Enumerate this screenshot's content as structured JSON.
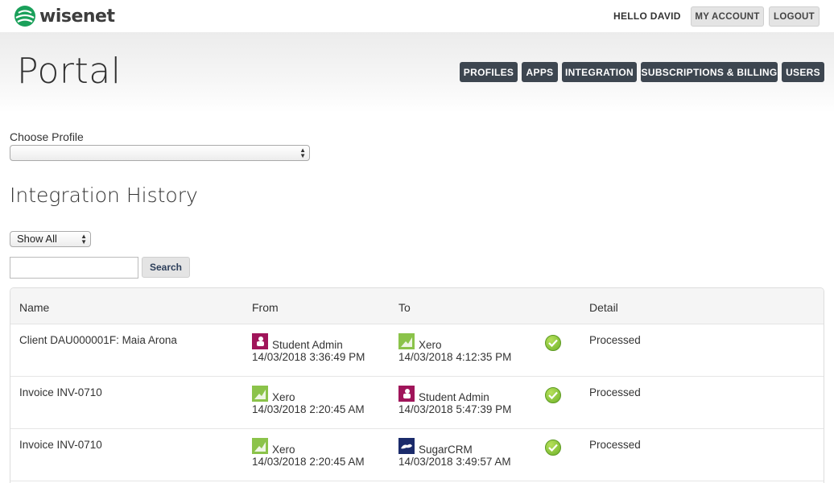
{
  "brand": {
    "name": "wisenet"
  },
  "topbar": {
    "greeting": "HELLO DAVID",
    "account_label": "MY ACCOUNT",
    "logout_label": "LOGOUT"
  },
  "header": {
    "title": "Portal",
    "nav": [
      "PROFILES",
      "APPS",
      "INTEGRATION",
      "SUBSCRIPTIONS & BILLING",
      "USERS"
    ]
  },
  "profile": {
    "label": "Choose Profile",
    "value": ""
  },
  "history": {
    "heading": "Integration History",
    "filter_value": "Show All",
    "search_value": "",
    "search_label": "Search"
  },
  "table": {
    "headers": {
      "name": "Name",
      "from": "From",
      "to": "To",
      "detail": "Detail"
    },
    "rows": [
      {
        "name": "Client DAU000001F: Maia Arona",
        "from": {
          "app": "Student Admin",
          "icon": "student-admin-icon",
          "time": "14/03/2018 3:36:49 PM"
        },
        "to": {
          "app": "Xero",
          "icon": "xero-icon",
          "time": "14/03/2018 4:12:35 PM"
        },
        "status_icon": "check-icon",
        "detail": "Processed"
      },
      {
        "name": "Invoice INV-0710",
        "from": {
          "app": "Xero",
          "icon": "xero-icon",
          "time": "14/03/2018 2:20:45 AM"
        },
        "to": {
          "app": "Student Admin",
          "icon": "student-admin-icon",
          "time": "14/03/2018 5:47:39 PM"
        },
        "status_icon": "check-icon",
        "detail": "Processed"
      },
      {
        "name": "Invoice INV-0710",
        "from": {
          "app": "Xero",
          "icon": "xero-icon",
          "time": "14/03/2018 2:20:45 AM"
        },
        "to": {
          "app": "SugarCRM",
          "icon": "sugarcrm-icon",
          "time": "14/03/2018 3:49:57 AM"
        },
        "status_icon": "check-icon",
        "detail": "Processed"
      }
    ]
  },
  "colors": {
    "nav_bg": "#3d4650",
    "brand_green": "#1aa05a",
    "student_admin": "#a0155a",
    "xero_green": "#8bc34a",
    "sugarcrm": "#1b2b6b",
    "status_green": "#7fc236"
  }
}
